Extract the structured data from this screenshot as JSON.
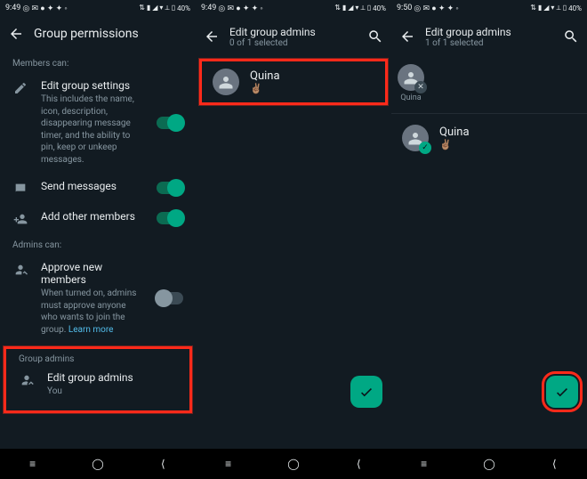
{
  "statusbar": {
    "time1": "9:49",
    "time2": "9:49",
    "time3": "9:50",
    "battery": "40%",
    "left_icons": "◎ ✉ ● ✦ ✦ ◦",
    "right_icons": "⇅ ▮ ◢ ▾ ⟂ ▯"
  },
  "panel1": {
    "title": "Group permissions",
    "members_label": "Members can:",
    "edit_settings_title": "Edit group settings",
    "edit_settings_desc": "This includes the name, icon, description, disappearing message timer, and the ability to pin, keep or unkeep messages.",
    "send_messages": "Send messages",
    "add_members": "Add other members",
    "admins_label": "Admins can:",
    "approve_title": "Approve new members",
    "approve_desc": "When turned on, admins must approve anyone who wants to join the group.",
    "learn_more": "Learn more",
    "group_admins_label": "Group admins",
    "edit_admins_title": "Edit group admins",
    "edit_admins_sub": "You"
  },
  "panel2": {
    "title": "Edit group admins",
    "sub": "0 of 1 selected",
    "contact_name": "Quina",
    "contact_status": "✌🏽"
  },
  "panel3": {
    "title": "Edit group admins",
    "sub": "1 of 1 selected",
    "chip_name": "Quina",
    "contact_name": "Quina",
    "contact_status": "✌🏽"
  }
}
